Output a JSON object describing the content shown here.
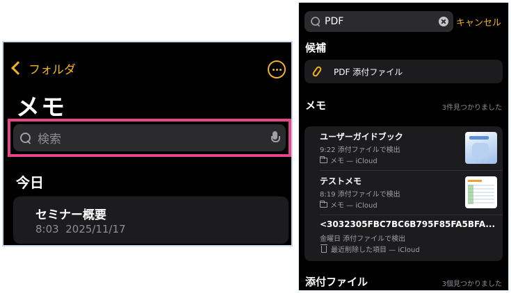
{
  "left": {
    "nav": {
      "back_label": "フォルダ"
    },
    "title": "メモ",
    "search": {
      "placeholder": "検索"
    },
    "section_today": "今日",
    "memo": {
      "title": "セミナー概要",
      "time": "8:03",
      "date": "2025/11/17"
    }
  },
  "right": {
    "search": {
      "query": "PDF",
      "cancel_label": "キャンセル"
    },
    "suggestions": {
      "heading": "候補",
      "item_label": "PDF 添付ファイル"
    },
    "memos": {
      "heading": "メモ",
      "count": "3件見つかりました",
      "results": [
        {
          "title": "ユーザーガイドブック",
          "subtitle": "9:22  添付ファイルで検出",
          "location": "メモ — iCloud",
          "thumbnail": "guide-thumbnail"
        },
        {
          "title": "テストメモ",
          "subtitle": "8:19  添付ファイルで検出",
          "location": "メモ — iCloud",
          "thumbnail": "spreadsheet-thumbnail"
        },
        {
          "title": "<3032305FBC7BC6B795F85FA5BFA...",
          "subtitle": "金曜日  添付ファイルで検出",
          "location": "最近削除した項目 — iCloud",
          "thumbnail": ""
        }
      ]
    },
    "attachments": {
      "heading": "添付ファイル",
      "count": "3個見つかりました"
    }
  },
  "colors": {
    "accent": "#f0b323",
    "highlight": "#e8448c",
    "background": "#000000",
    "card": "#1c1c1e"
  }
}
